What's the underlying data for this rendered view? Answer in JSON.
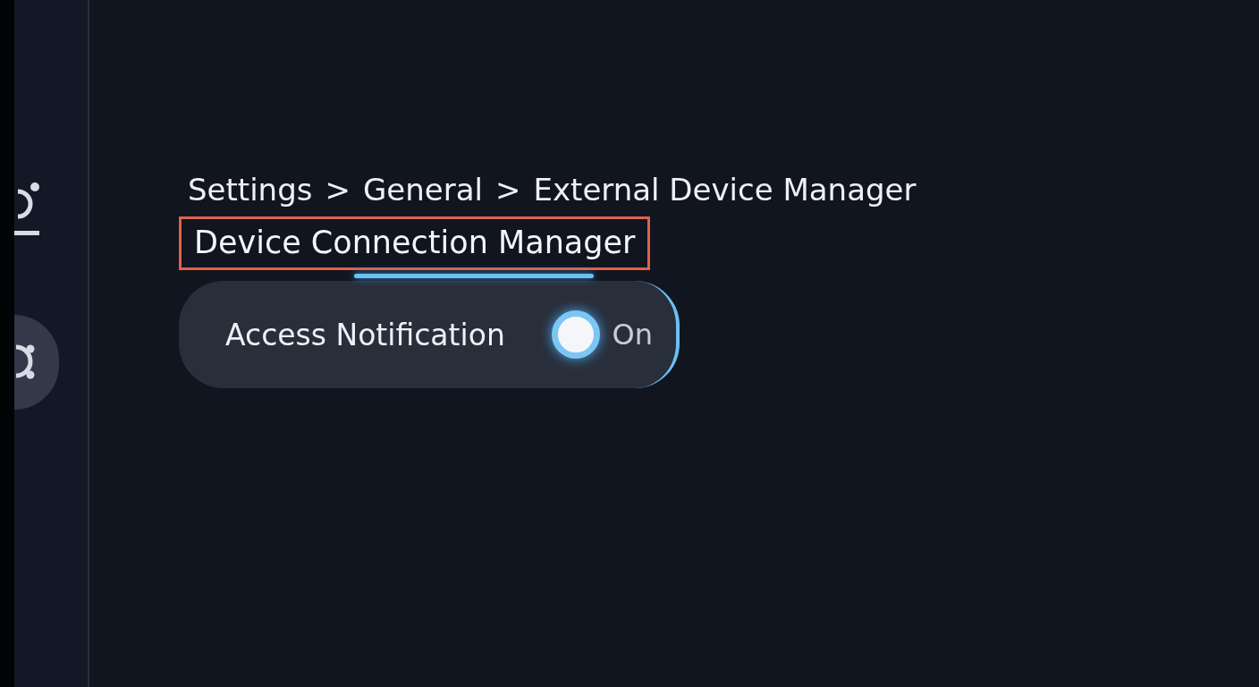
{
  "sidebar": {
    "items": [
      {
        "kind": "ring-dot",
        "selected": false
      },
      {
        "kind": "ring-two-dots",
        "selected": true
      }
    ]
  },
  "breadcrumb": {
    "separator": ">",
    "items": [
      "Settings",
      "General",
      "External Device Manager"
    ]
  },
  "title": {
    "text": "Device Connection Manager",
    "highlighted": true
  },
  "setting": {
    "label": "Access Notification",
    "on": true,
    "value": "On",
    "focused": true
  }
}
